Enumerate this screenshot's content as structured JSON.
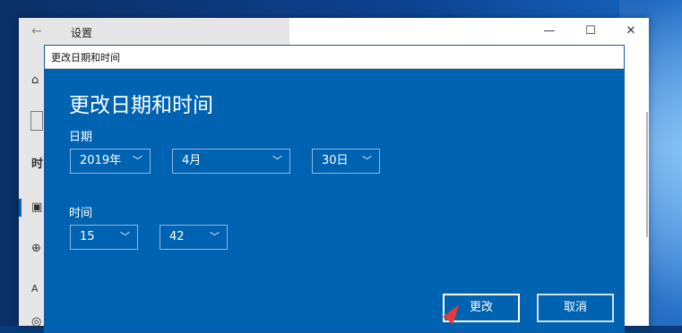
{
  "settings_window": {
    "title": "设置",
    "back_icon": "back-arrow-icon",
    "minimize": "—",
    "maximize": "☐",
    "close": "✕",
    "sidebar_partial_label": "时"
  },
  "dialog": {
    "window_title": "更改日期和时间",
    "heading": "更改日期和时间",
    "date_label": "日期",
    "year": "2019年",
    "month": "4月",
    "day": "30日",
    "time_label": "时间",
    "hour": "15",
    "minute": "42",
    "change_button": "更改",
    "cancel_button": "取消"
  },
  "colors": {
    "dialog_bg": "#0063b1",
    "cursor": "#e23c3c"
  }
}
